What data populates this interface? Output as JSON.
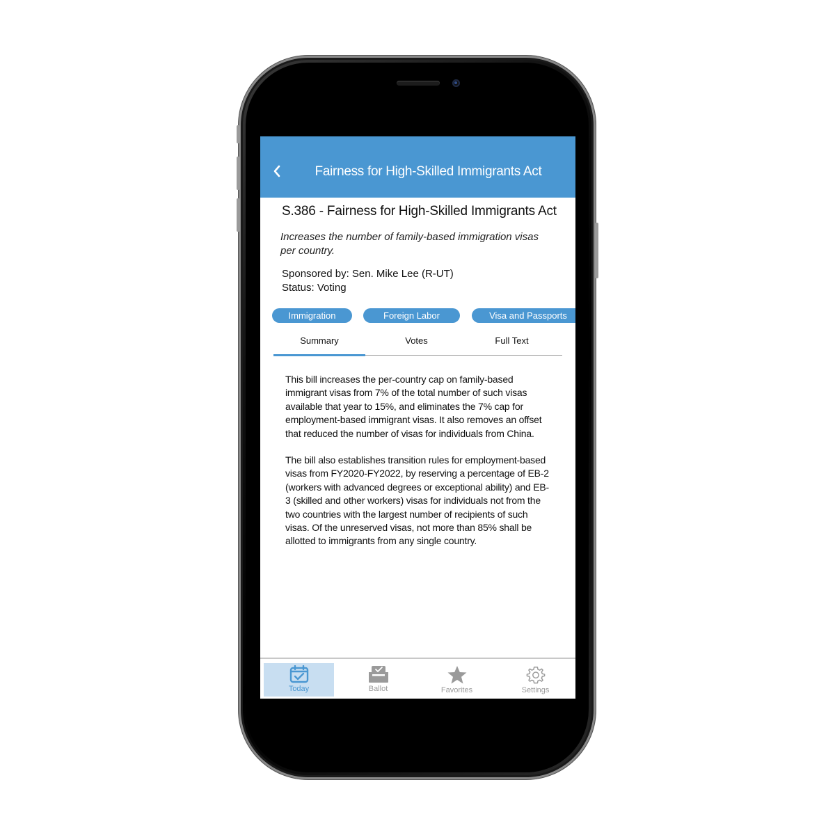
{
  "header": {
    "title": "Fairness for High-Skilled Immigrants Act"
  },
  "bill": {
    "title": "S.386 - Fairness for High-Skilled Immigrants Act",
    "description": "Increases the number of family-based immigration visas per country.",
    "sponsor": "Sponsored by: Sen. Mike Lee (R-UT)",
    "status": "Status: Voting",
    "tags": [
      "Immigration",
      "Foreign Labor",
      "Visa and Passports"
    ]
  },
  "tabs": {
    "items": [
      "Summary",
      "Votes",
      "Full Text"
    ],
    "selected": "Summary"
  },
  "summary": {
    "paragraphs": [
      "This bill increases the per-country cap on family-based immigrant visas from 7% of the total number of such visas available that year to 15%, and eliminates the 7% cap for employment-based immigrant visas. It also removes an offset that reduced the number of visas for individuals from China.",
      "The bill also establishes transition rules for employment-based visas from FY2020-FY2022, by reserving a percentage of EB-2 (workers with advanced degrees or exceptional ability) and EB-3 (skilled and other workers) visas for individuals not from the two countries with the largest number of recipients of such visas. Of the unreserved visas, not more than 85% shall be allotted to immigrants from any single country."
    ]
  },
  "tabbar": {
    "items": [
      {
        "label": "Today",
        "icon": "calendar-check-icon",
        "active": true
      },
      {
        "label": "Ballot",
        "icon": "ballot-box-icon",
        "active": false
      },
      {
        "label": "Favorites",
        "icon": "star-icon",
        "active": false
      },
      {
        "label": "Settings",
        "icon": "gear-icon",
        "active": false
      }
    ]
  },
  "colors": {
    "accent": "#4a97d2",
    "active_tab_bg": "#c8def1",
    "inactive": "#9a9a9a"
  }
}
